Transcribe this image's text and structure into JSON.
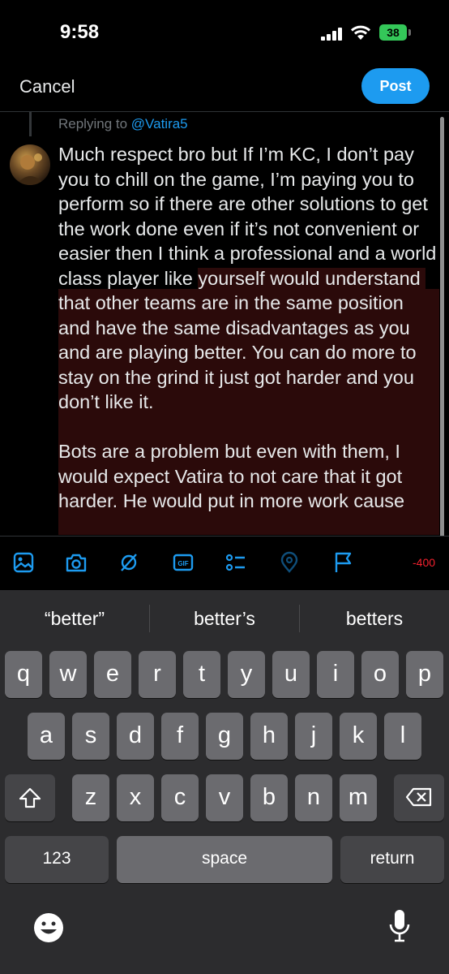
{
  "status_bar": {
    "time": "9:58",
    "battery": "38"
  },
  "header": {
    "cancel_label": "Cancel",
    "post_label": "Post"
  },
  "reply": {
    "prefix": "Replying to ",
    "handle": "@Vatira5"
  },
  "compose": {
    "text_within": "Much respect bro but If I’m KC, I don’t pay you to chill on the game, I’m paying you to perform so if there are other solutions to get the work done even if it’s not convenient or easier then I think a professional and a world class player like ",
    "text_over_first": "yourself would understand that other teams are in the same position and have the same disadvantages as you and are playing better. You can do more to stay on the grind it just got harder and you don’t like it.",
    "text_over_second": "Bots are a problem but even with them, I would expect Vatira to not care that it got harder. He would put in more work cause"
  },
  "toolbar": {
    "counter": "-400",
    "icons": [
      "image-icon",
      "camera-icon",
      "grok-icon",
      "gif-icon",
      "poll-icon",
      "location-icon",
      "flag-icon"
    ]
  },
  "keyboard": {
    "suggestions": [
      "“better”",
      "better’s",
      "betters"
    ],
    "row1": [
      "q",
      "w",
      "e",
      "r",
      "t",
      "y",
      "u",
      "i",
      "o",
      "p"
    ],
    "row2": [
      "a",
      "s",
      "d",
      "f",
      "g",
      "h",
      "j",
      "k",
      "l"
    ],
    "row3": [
      "z",
      "x",
      "c",
      "v",
      "b",
      "n",
      "m"
    ],
    "numbers_label": "123",
    "space_label": "space",
    "return_label": "return"
  },
  "colors": {
    "accent": "#1d9bf0",
    "over_limit_bg": "#2b0a0a",
    "counter": "#f4212e"
  }
}
